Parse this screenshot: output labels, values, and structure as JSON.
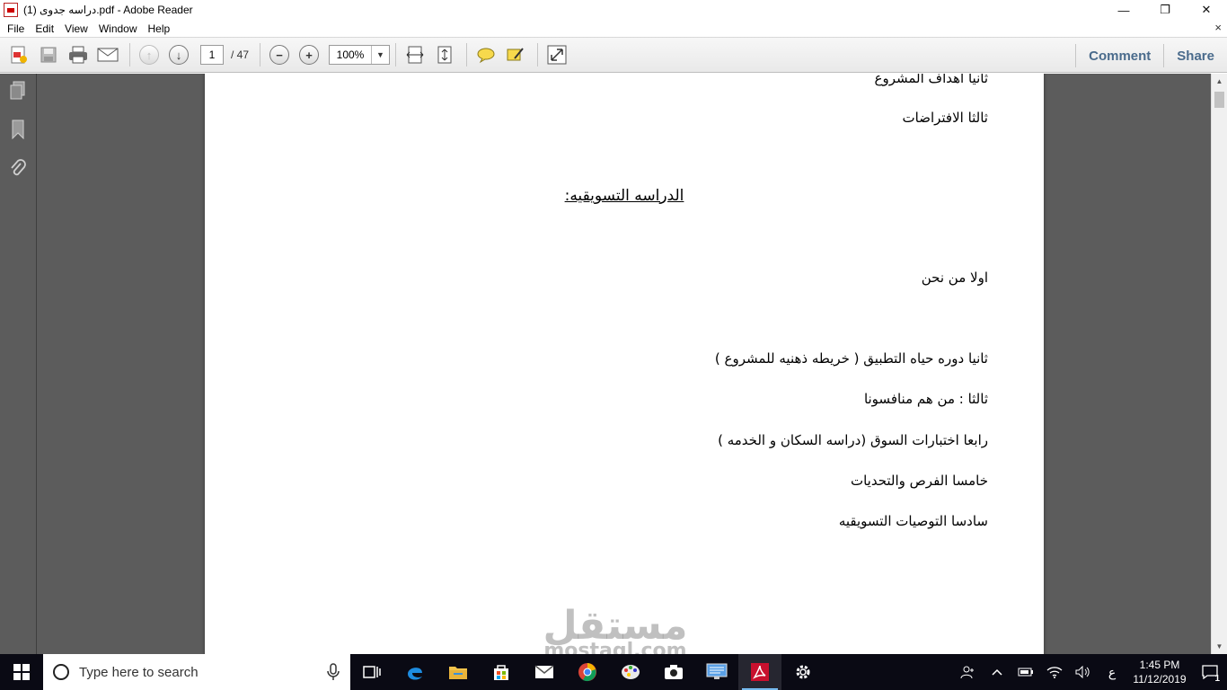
{
  "window": {
    "title": "دراسه جدوى (1).pdf - Adobe Reader",
    "controls": {
      "minimize": "—",
      "restore": "❐",
      "close": "✕"
    }
  },
  "menu": {
    "items": [
      "File",
      "Edit",
      "View",
      "Window",
      "Help"
    ],
    "close_symbol": "×"
  },
  "toolbar": {
    "current_page": "1",
    "total_pages": "/ 47",
    "zoom": "100%",
    "zoom_arrow": "▼",
    "comment_label": "Comment",
    "share_label": "Share"
  },
  "document": {
    "lines": [
      "ثانيا اهداف المشروع",
      "ثالثا الافتراضات",
      "اولا من نحن",
      "ثانيا دوره حياه التطبيق ( خريطه ذهنيه للمشروع )",
      "ثالثا : من هم منافسونا",
      "رابعا اختبارات السوق (دراسه السكان و الخدمه )",
      "خامسا الفرص والتحديات",
      "سادسا التوصيات التسويقيه"
    ],
    "heading": "الدراسه التسويقيه:"
  },
  "watermark": {
    "arabic": "مستقل",
    "latin": "mostaql.com"
  },
  "taskbar": {
    "search_placeholder": "Type here to search",
    "time": "1:45 PM",
    "date": "11/12/2019",
    "language": "ع",
    "notification_count": "1"
  }
}
